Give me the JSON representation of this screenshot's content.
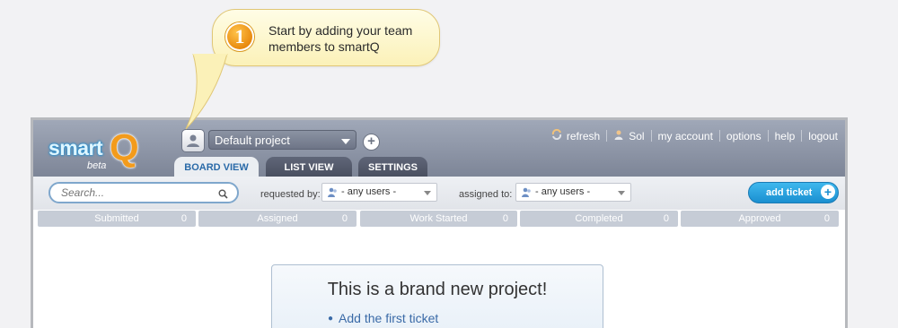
{
  "tooltip": {
    "step": "1",
    "text": "Start by adding your team members to smartQ"
  },
  "logo": {
    "word": "smart",
    "letter": "Q",
    "badge": "beta"
  },
  "project": {
    "selected": "Default project"
  },
  "topnav": [
    "refresh",
    "Sol",
    "my account",
    "options",
    "help",
    "logout"
  ],
  "tabs": [
    {
      "label": "BOARD VIEW",
      "active": true
    },
    {
      "label": "LIST VIEW",
      "active": false
    },
    {
      "label": "SETTINGS",
      "active": false
    }
  ],
  "filters": {
    "search_placeholder": "Search...",
    "requested_label": "requested by:",
    "requested_value": "- any users -",
    "assigned_label": "assigned to:",
    "assigned_value": "- any users -",
    "add_ticket": "add ticket"
  },
  "columns": [
    {
      "name": "Submitted",
      "count": "0"
    },
    {
      "name": "Assigned",
      "count": "0"
    },
    {
      "name": "Work Started",
      "count": "0"
    },
    {
      "name": "Completed",
      "count": "0"
    },
    {
      "name": "Approved",
      "count": "0"
    }
  ],
  "empty_state": {
    "title": "This is a brand new project!",
    "link": "Add the first ticket"
  },
  "colors": {
    "accent_blue": "#1a8fd0",
    "header_gray": "#8a92a3",
    "callout_yellow": "#fbf1b8",
    "logo_orange": "#f39b1c"
  }
}
